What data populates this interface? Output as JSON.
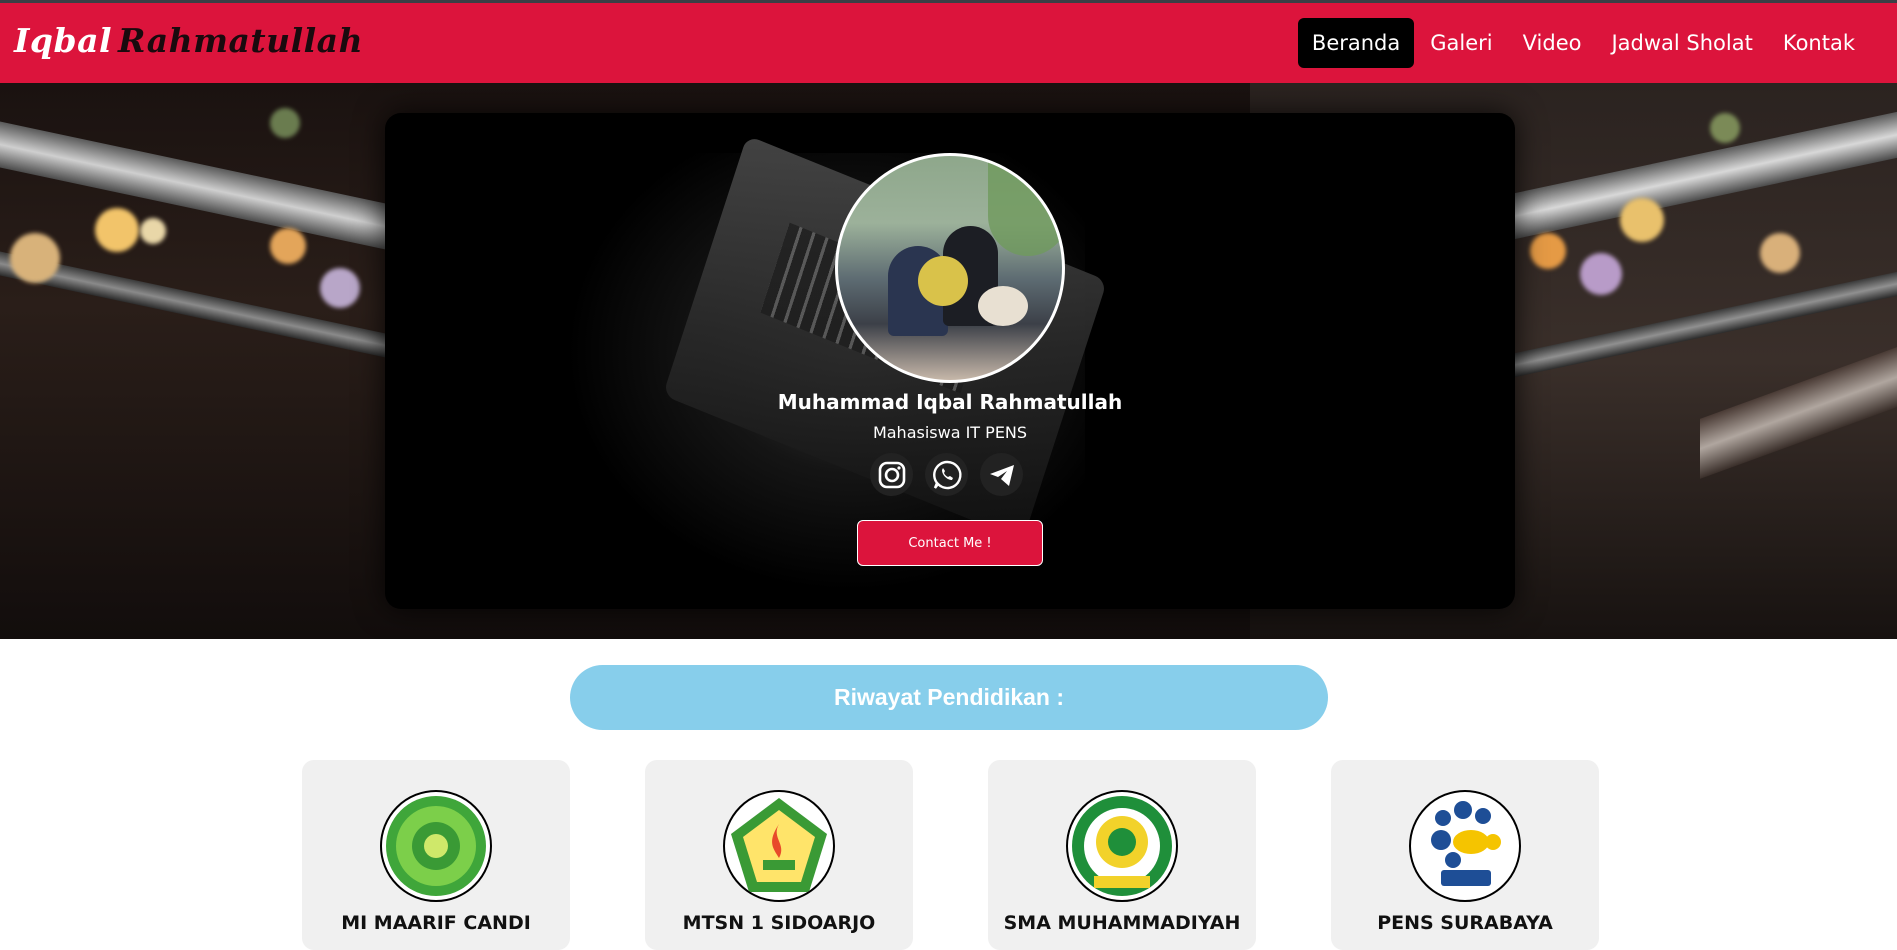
{
  "navbar": {
    "brand_first": "Iqbal",
    "brand_second": "Rahmatullah",
    "links": [
      "Beranda",
      "Galeri",
      "Video",
      "Jadwal Sholat",
      "Kontak"
    ],
    "active": "Beranda",
    "color": "#dc143c"
  },
  "profile": {
    "name": "Muhammad Iqbal Rahmatullah",
    "role": "Mahasiswa IT PENS",
    "socials": [
      "instagram-icon",
      "whatsapp-icon",
      "telegram-icon"
    ],
    "contact_label": "Contact Me !"
  },
  "education": {
    "title": "Riwayat Pendidikan :",
    "title_color": "#87ceeb",
    "schools": [
      {
        "name": "MI MAARIF CANDI"
      },
      {
        "name": "MTSN 1 SIDOARJO"
      },
      {
        "name": "SMA MUHAMMADIYAH"
      },
      {
        "name": "PENS SURABAYA"
      }
    ]
  }
}
